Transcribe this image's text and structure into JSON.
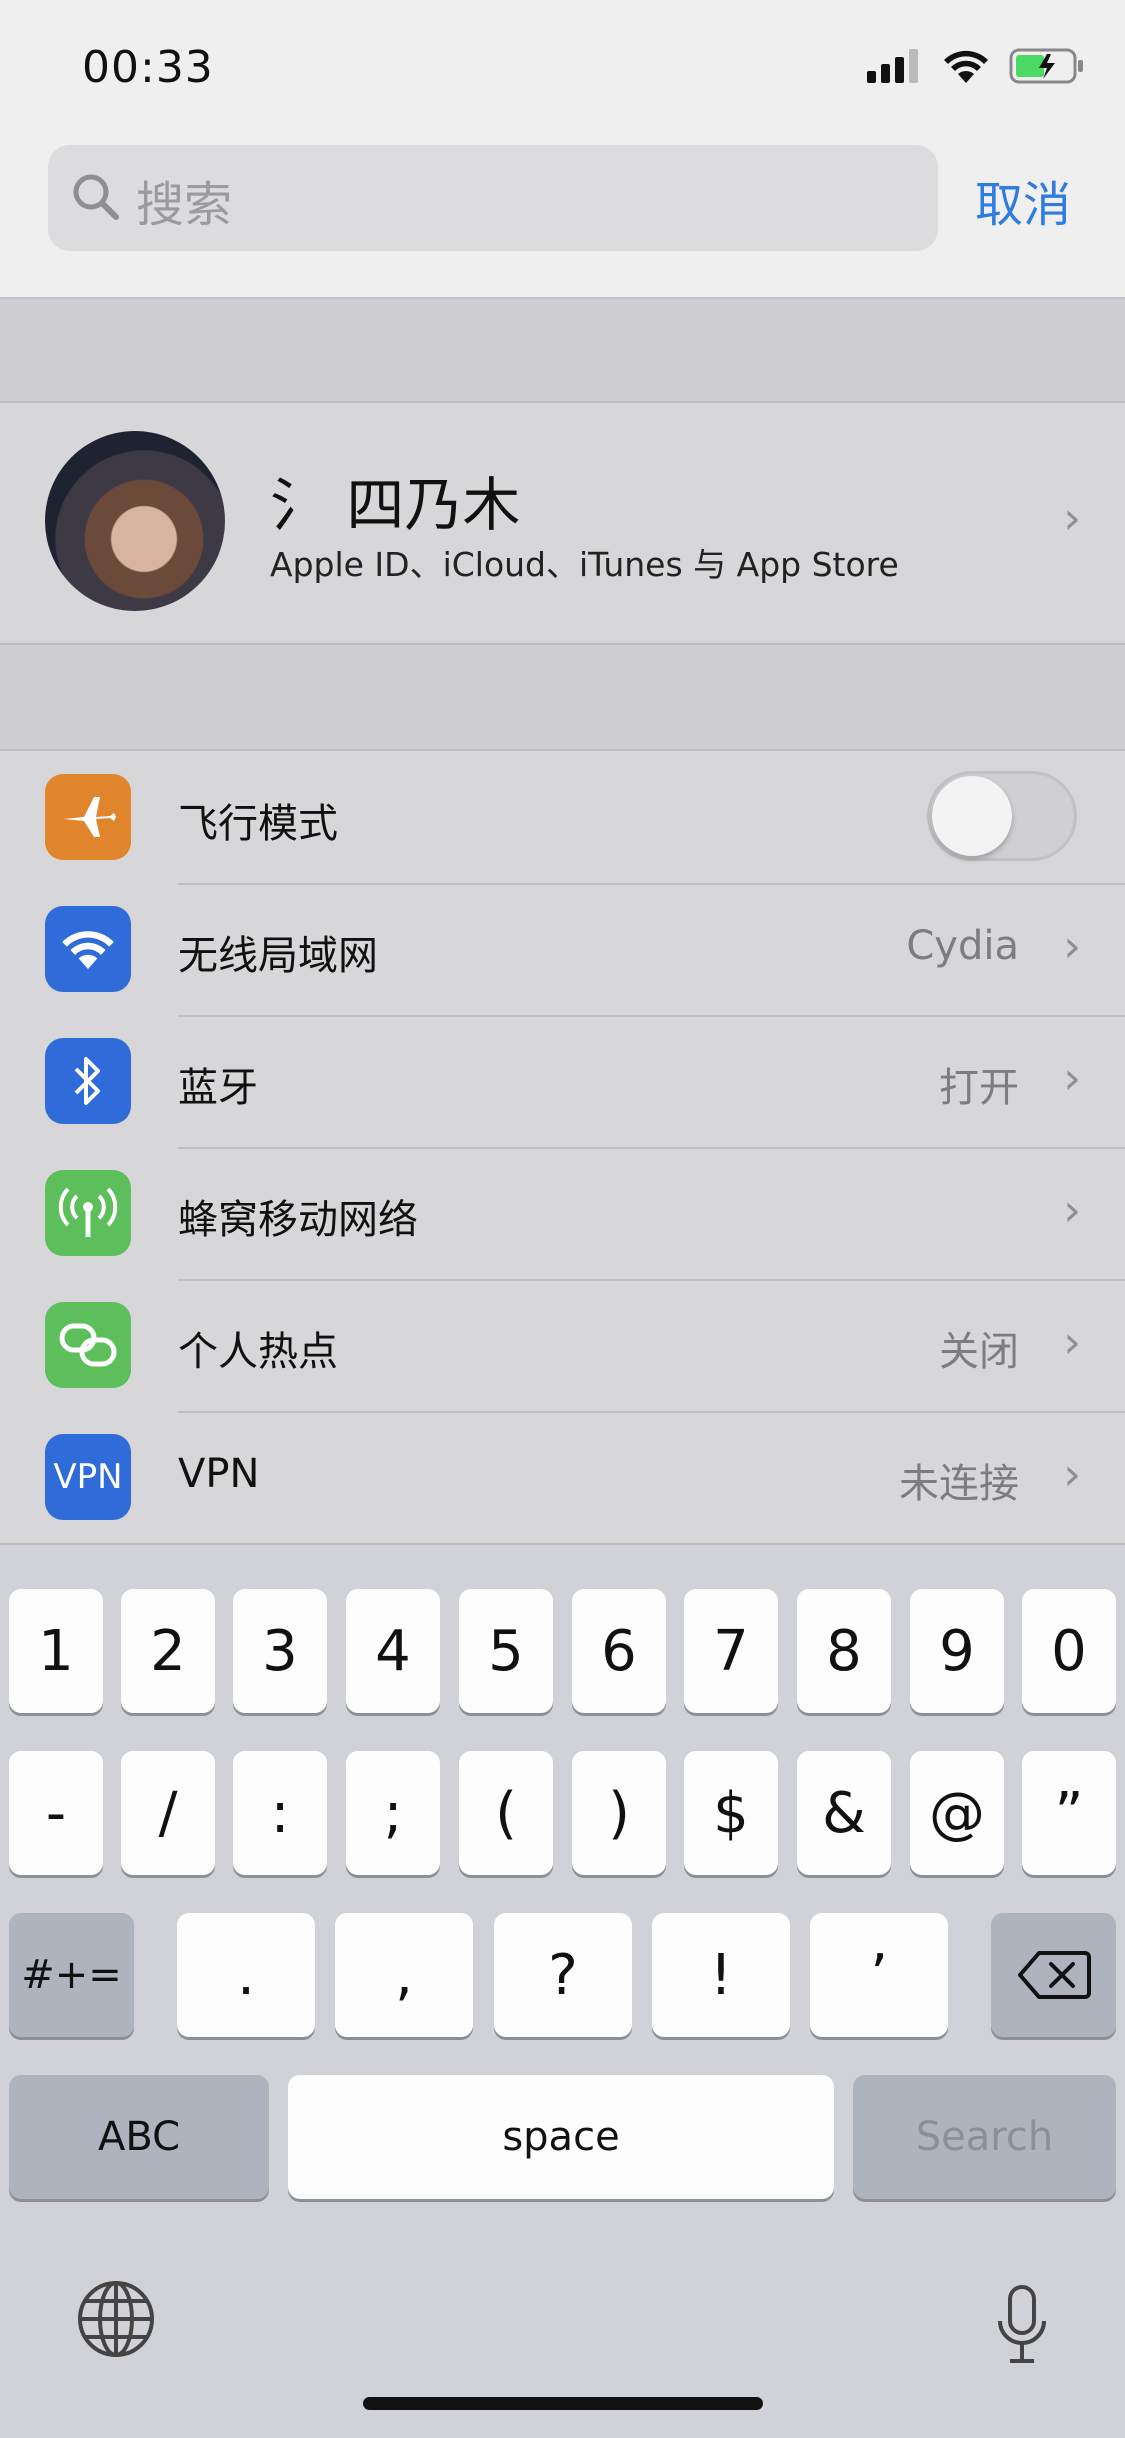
{
  "status_bar": {
    "time": "00:33"
  },
  "search": {
    "placeholder": "搜索",
    "cancel_label": "取消"
  },
  "profile": {
    "name": "氵 四乃木",
    "subtitle": "Apple ID、iCloud、iTunes 与 App Store"
  },
  "settings": [
    {
      "label": "飞行模式",
      "value": "",
      "icon": "airplane-icon",
      "color": "#e0852b",
      "toggle_on": false
    },
    {
      "label": "无线局域网",
      "value": "Cydia",
      "icon": "wifi-icon",
      "color": "#2f6bd9"
    },
    {
      "label": "蓝牙",
      "value": "打开",
      "icon": "bluetooth-icon",
      "color": "#2f6bd9"
    },
    {
      "label": "蜂窝移动网络",
      "value": "",
      "icon": "cellular-icon",
      "color": "#5cbf5c"
    },
    {
      "label": "个人热点",
      "value": "关闭",
      "icon": "hotspot-icon",
      "color": "#5cbf5c"
    },
    {
      "label": "VPN",
      "value": "未连接",
      "icon": "vpn-icon",
      "color": "#2f6bd9",
      "icon_text": "VPN"
    }
  ],
  "keyboard": {
    "row1": [
      "1",
      "2",
      "3",
      "4",
      "5",
      "6",
      "7",
      "8",
      "9",
      "0"
    ],
    "row2": [
      "-",
      "/",
      ":",
      ";",
      "(",
      ")",
      "$",
      "&",
      "@",
      "”"
    ],
    "row3": [
      ".",
      ",",
      "?",
      "!",
      "’"
    ],
    "symbols_key": "#+=",
    "abc_key": "ABC",
    "space_key": "space",
    "search_key": "Search"
  }
}
